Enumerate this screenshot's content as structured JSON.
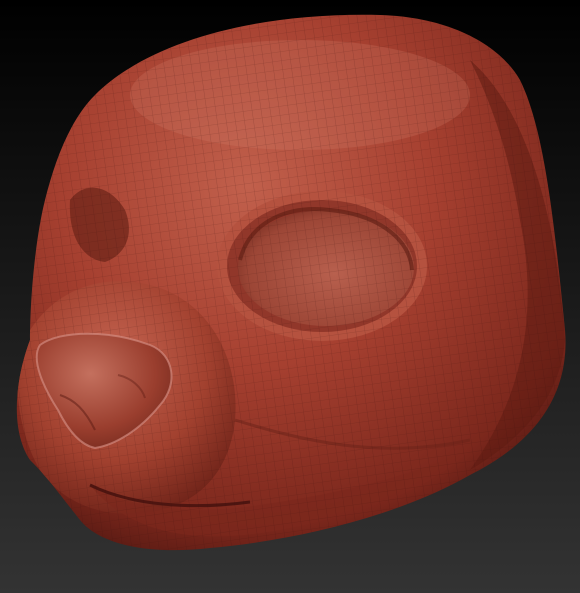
{
  "scene": {
    "subject": "sculpted-animal-head",
    "background_top": "#000000",
    "background_bottom": "#333333",
    "clay_base": "#a64030",
    "clay_dark": "#5a1a12",
    "clay_light": "#d98a78",
    "wireframe_color": "#3a0f0a"
  }
}
